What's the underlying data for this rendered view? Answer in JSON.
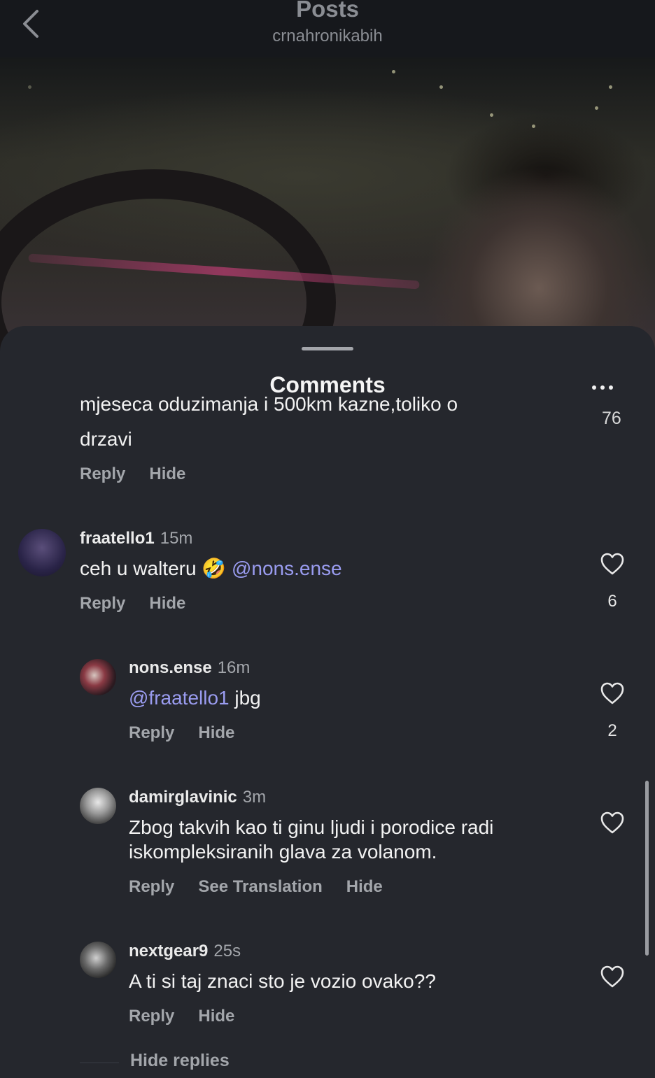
{
  "header": {
    "title": "Posts",
    "subtitle": "crnahronikabih"
  },
  "sheet": {
    "title": "Comments"
  },
  "partial_comment": {
    "line_cut": "mjeseca oduzimanja i 500km kazne,toliko o",
    "line2": "drzavi",
    "likes": "76",
    "reply_label": "Reply",
    "hide_label": "Hide"
  },
  "comments": [
    {
      "username": "fraatello1",
      "time": "15m",
      "text_before": "ceh u walteru",
      "emoji": "🤣",
      "mention": "@nons.ense",
      "text_after": "",
      "likes": "6",
      "reply_label": "Reply",
      "hide_label": "Hide"
    },
    {
      "username": "nons.ense",
      "time": "16m",
      "mention": "@fraatello1",
      "text_after": "jbg",
      "likes": "2",
      "reply_label": "Reply",
      "hide_label": "Hide"
    },
    {
      "username": "damirglavinic",
      "time": "3m",
      "line1": "Zbog takvih kao ti ginu ljudi i porodice radi",
      "line2": "iskompleksiranih glava za volanom.",
      "reply_label": "Reply",
      "translate_label": "See Translation",
      "hide_label": "Hide"
    },
    {
      "username": "nextgear9",
      "time": "25s",
      "text": "A ti si taj znaci sto je vozio ovako??",
      "reply_label": "Reply",
      "hide_label": "Hide"
    }
  ],
  "hide_replies_label": "Hide replies",
  "icons": {
    "back": "chevron-left-icon",
    "more": "more-horizontal-icon",
    "like": "heart-outline-icon"
  },
  "colors": {
    "mention": "#9a9cf0",
    "sheet_bg": "#25272d",
    "muted": "#a3a6ab"
  }
}
